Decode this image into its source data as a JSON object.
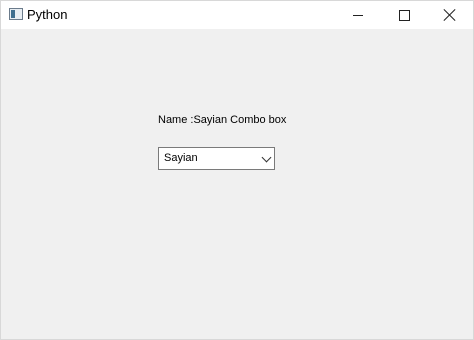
{
  "window": {
    "title": "Python",
    "icon": "python-window-icon",
    "controls": {
      "minimize_icon": "minimize-icon",
      "maximize_icon": "maximize-icon",
      "close_icon": "close-icon"
    }
  },
  "form": {
    "label": "Name :Sayian Combo box",
    "combo": {
      "selected": "Sayian",
      "dropdown_icon": "chevron-down-icon"
    }
  }
}
